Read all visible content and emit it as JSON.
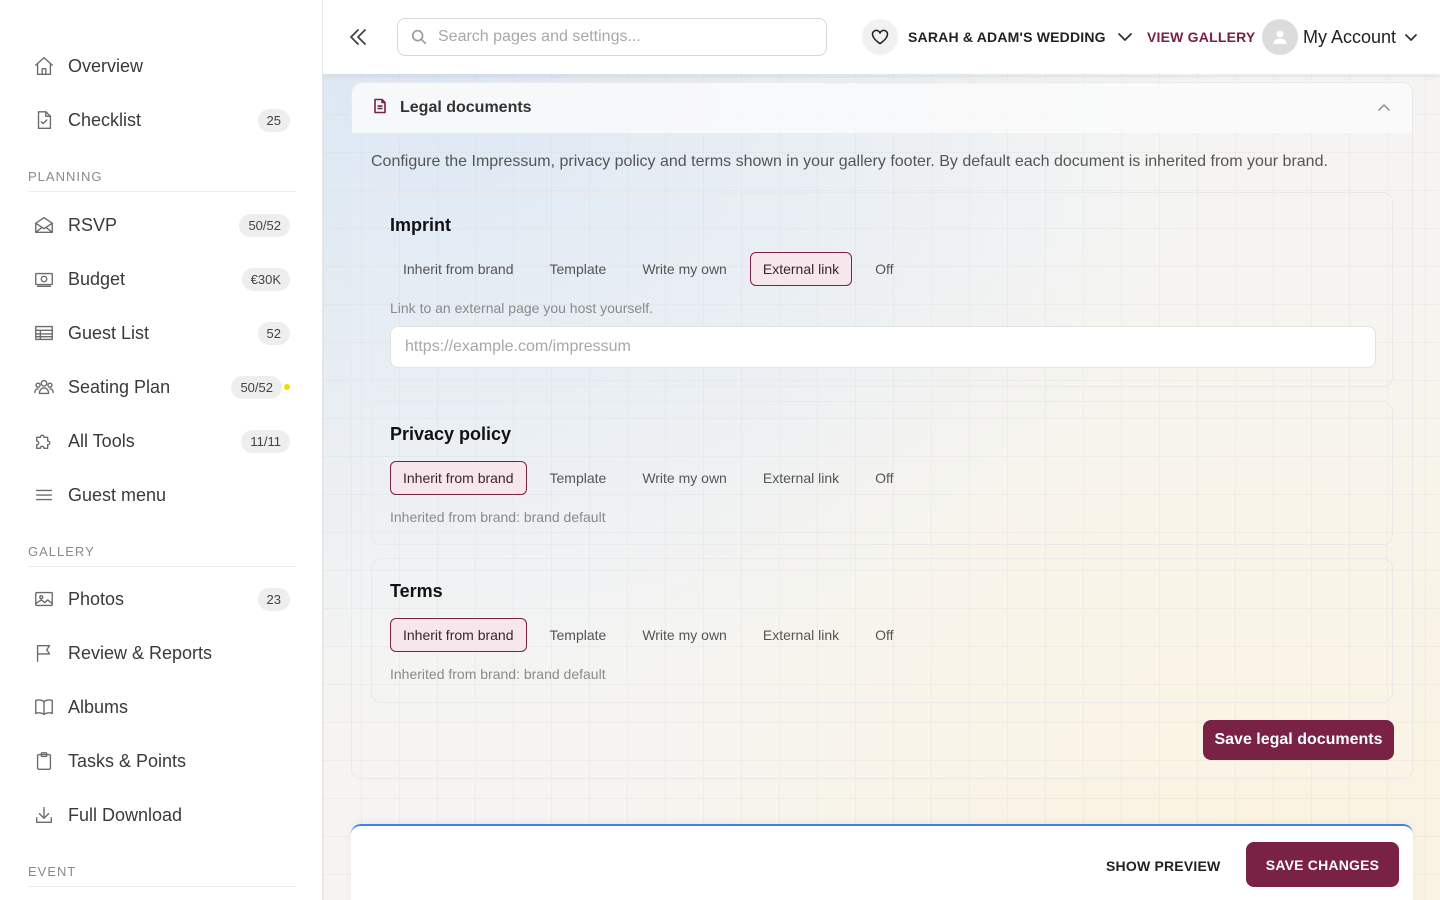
{
  "sidebar": {
    "items": [
      {
        "label": "Overview",
        "icon": "home-icon"
      },
      {
        "label": "Checklist",
        "icon": "checklist-icon",
        "badge": "25"
      },
      {
        "label": "RSVP",
        "icon": "envelope-icon",
        "badge": "50/52"
      },
      {
        "label": "Budget",
        "icon": "money-icon",
        "badge": "€30K"
      },
      {
        "label": "Guest List",
        "icon": "table-icon",
        "badge": "52"
      },
      {
        "label": "Seating Plan",
        "icon": "people-icon",
        "badge": "50/52",
        "dot_color": "#f5d800"
      },
      {
        "label": "All Tools",
        "icon": "puzzle-icon",
        "badge": "11/11"
      },
      {
        "label": "Guest menu",
        "icon": "menu-icon"
      },
      {
        "label": "Photos",
        "icon": "image-icon",
        "badge": "23"
      },
      {
        "label": "Review & Reports",
        "icon": "flag-icon"
      },
      {
        "label": "Albums",
        "icon": "book-icon"
      },
      {
        "label": "Tasks & Points",
        "icon": "clipboard-icon"
      },
      {
        "label": "Full Download",
        "icon": "download-icon"
      }
    ],
    "sections": [
      "PLANNING",
      "GALLERY",
      "EVENT"
    ]
  },
  "topbar": {
    "search_placeholder": "Search pages and settings...",
    "event_name": "SARAH & ADAM'S WEDDING",
    "view_gallery": "VIEW GALLERY",
    "account": "My Account"
  },
  "card": {
    "title": "Legal documents",
    "intro": "Configure the Impressum, privacy policy and terms shown in your gallery footer. By default each document is inherited from your brand.",
    "options": [
      "Inherit from brand",
      "Template",
      "Write my own",
      "External link",
      "Off"
    ],
    "documents": [
      {
        "title": "Imprint",
        "selected": "External link",
        "hint": "Link to an external page you host yourself.",
        "url_placeholder": "https://example.com/impressum"
      },
      {
        "title": "Privacy policy",
        "selected": "Inherit from brand",
        "hint": "Inherited from brand: brand default"
      },
      {
        "title": "Terms",
        "selected": "Inherit from brand",
        "hint": "Inherited from brand: brand default"
      }
    ],
    "save_label": "Save legal documents"
  },
  "footer": {
    "show_preview": "SHOW PREVIEW",
    "save_changes": "SAVE CHANGES"
  },
  "colors": {
    "accent": "#7a2146",
    "accent_light": "#f6e7ec",
    "focus_line": "#3b82f6",
    "status_dot": "#f5d800"
  }
}
